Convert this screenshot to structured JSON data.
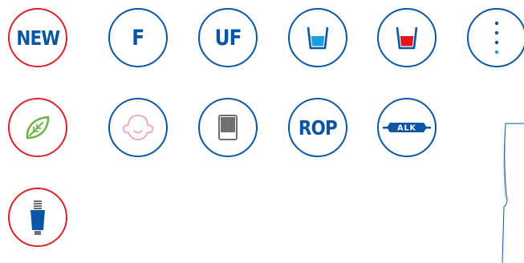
{
  "badges": {
    "new": {
      "label": "NEW",
      "border": "#d9222a"
    },
    "f": {
      "label": "F",
      "border": "#0a56a4"
    },
    "uf": {
      "label": "UF",
      "border": "#0a56a4"
    },
    "rop": {
      "label": "ROP",
      "border": "#0a56a4"
    },
    "alk": {
      "label": "ALK",
      "border": "#0a56a4"
    }
  },
  "icons": [
    "glass-blue-water-icon",
    "glass-red-water-icon",
    "vertical-dots-icon",
    "leaf-icon",
    "baby-face-icon",
    "filter-block-icon",
    "cartridge-icon"
  ],
  "colors": {
    "brand_blue": "#0a56a4",
    "accent_red": "#d9222a",
    "water_blue": "#1aa0e0",
    "water_red": "#e5141e",
    "leaf_green": "#6ab045",
    "baby_pink": "#e9a4c2",
    "filter_gray": "#6f6f6f"
  }
}
